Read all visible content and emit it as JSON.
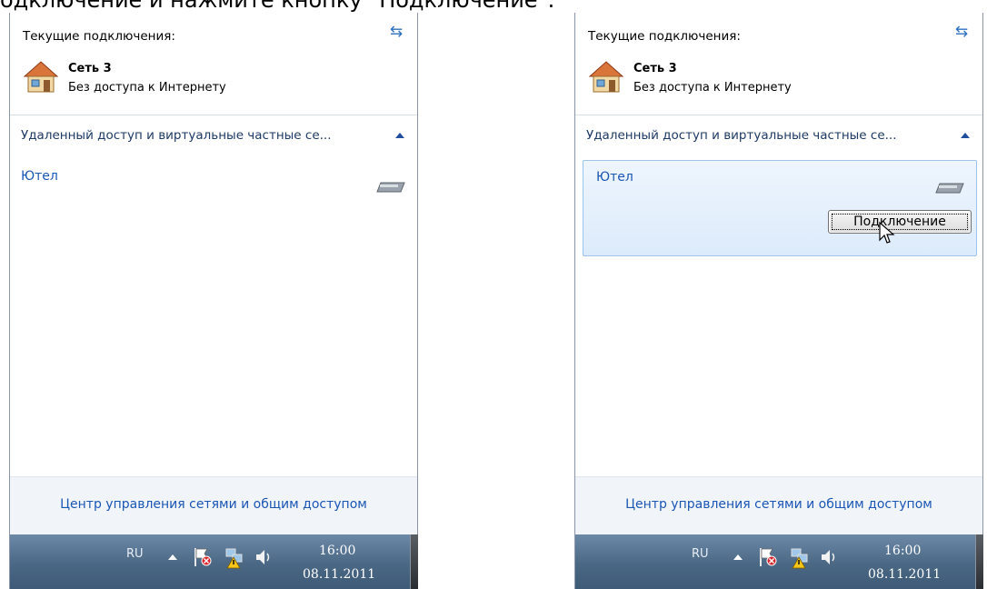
{
  "caption": "одключение и нажмите кнопку \"Подключение\".",
  "colors": {
    "link": "#1a56b4",
    "taskbar": "#4a6784",
    "selected_row": "#dcebfb"
  },
  "panels": [
    {
      "current_title": "Текущие подключения:",
      "refresh_icon": "refresh-icon",
      "network": {
        "name": "Сеть 3",
        "status": "Без доступа к Интернету",
        "icon": "house-icon"
      },
      "vpn_section_label": "Удаленный доступ и виртуальные частные се...",
      "connection": {
        "name": "Ютел",
        "icon": "modem-icon",
        "selected": false
      },
      "footer_link": "Центр управления сетями и общим доступом",
      "taskbar": {
        "lang": "RU",
        "time": "16:00",
        "date": "08.11.2011"
      }
    },
    {
      "current_title": "Текущие подключения:",
      "refresh_icon": "refresh-icon",
      "network": {
        "name": "Сеть 3",
        "status": "Без доступа к Интернету",
        "icon": "house-icon"
      },
      "vpn_section_label": "Удаленный доступ и виртуальные частные се...",
      "connection": {
        "name": "Ютел",
        "icon": "modem-icon",
        "selected": true,
        "button_label": "Подключение"
      },
      "footer_link": "Центр управления сетями и общим доступом",
      "taskbar": {
        "lang": "RU",
        "time": "16:00",
        "date": "08.11.2011"
      }
    }
  ]
}
